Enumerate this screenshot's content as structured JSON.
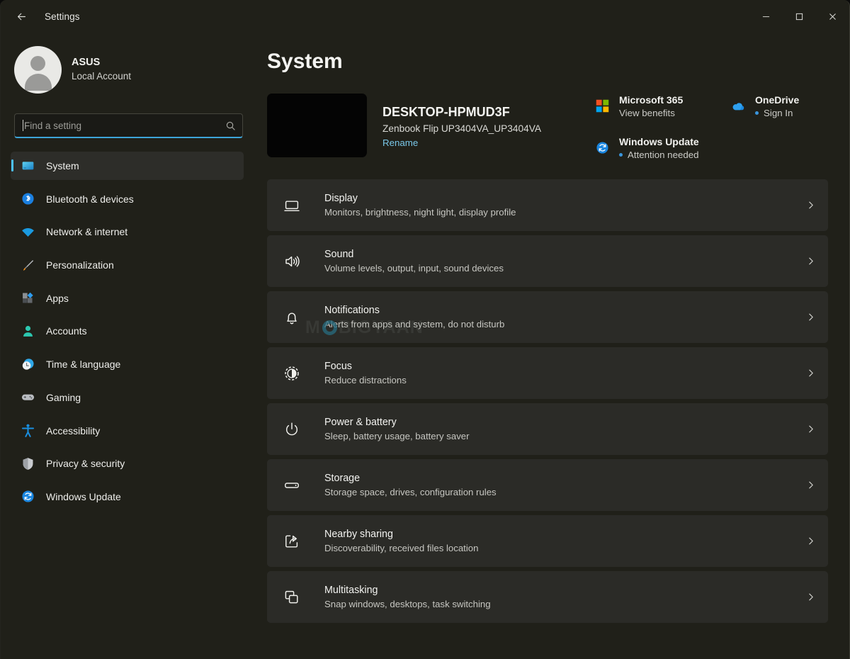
{
  "titlebar": {
    "back_icon": "back-arrow-icon",
    "title": "Settings",
    "minimize_label": "Minimize",
    "maximize_label": "Maximize",
    "close_label": "Close"
  },
  "sidebar": {
    "account": {
      "name": "ASUS",
      "subtitle": "Local Account",
      "avatar_icon": "person-avatar-icon"
    },
    "search": {
      "placeholder": "Find a setting",
      "value": "",
      "icon": "search-icon"
    },
    "items": [
      {
        "label": "System",
        "icon": "monitor-icon",
        "active": true
      },
      {
        "label": "Bluetooth & devices",
        "icon": "bluetooth-icon",
        "active": false
      },
      {
        "label": "Network & internet",
        "icon": "wifi-icon",
        "active": false
      },
      {
        "label": "Personalization",
        "icon": "paintbrush-icon",
        "active": false
      },
      {
        "label": "Apps",
        "icon": "apps-icon",
        "active": false
      },
      {
        "label": "Accounts",
        "icon": "account-person-icon",
        "active": false
      },
      {
        "label": "Time & language",
        "icon": "clock-icon",
        "active": false
      },
      {
        "label": "Gaming",
        "icon": "gamepad-icon",
        "active": false
      },
      {
        "label": "Accessibility",
        "icon": "accessibility-person-icon",
        "active": false
      },
      {
        "label": "Privacy & security",
        "icon": "shield-icon",
        "active": false
      },
      {
        "label": "Windows Update",
        "icon": "update-refresh-icon",
        "active": false
      }
    ]
  },
  "main": {
    "page_title": "System",
    "device": {
      "name": "DESKTOP-HPMUD3F",
      "model": "Zenbook Flip UP3404VA_UP3404VA",
      "rename_label": "Rename",
      "thumbnail_color": "#040404"
    },
    "cloud_cards": [
      {
        "title": "Microsoft 365",
        "subtitle": "View benefits",
        "icon": "microsoft-logo-icon",
        "has_dot": false
      },
      {
        "title": "OneDrive",
        "subtitle": "Sign In",
        "icon": "onedrive-cloud-icon",
        "has_dot": true
      },
      {
        "title": "Windows Update",
        "subtitle": "Attention needed",
        "icon": "update-refresh-icon",
        "has_dot": true
      }
    ],
    "rows": [
      {
        "title": "Display",
        "subtitle": "Monitors, brightness, night light, display profile",
        "icon": "display-monitor-icon"
      },
      {
        "title": "Sound",
        "subtitle": "Volume levels, output, input, sound devices",
        "icon": "speaker-icon"
      },
      {
        "title": "Notifications",
        "subtitle": "Alerts from apps and system, do not disturb",
        "icon": "bell-icon"
      },
      {
        "title": "Focus",
        "subtitle": "Reduce distractions",
        "icon": "focus-moon-icon"
      },
      {
        "title": "Power & battery",
        "subtitle": "Sleep, battery usage, battery saver",
        "icon": "power-icon"
      },
      {
        "title": "Storage",
        "subtitle": "Storage space, drives, configuration rules",
        "icon": "storage-drive-icon"
      },
      {
        "title": "Nearby sharing",
        "subtitle": "Discoverability, received files location",
        "icon": "share-arrow-icon"
      },
      {
        "title": "Multitasking",
        "subtitle": "Snap windows, desktops, task switching",
        "icon": "multitasking-windows-icon"
      }
    ],
    "chevron_icon": "chevron-right-icon"
  },
  "watermark": {
    "text_before": "M",
    "text_after": "BIGYAAN"
  },
  "colors": {
    "accent": "#4cc2ff",
    "link": "#79c7e8",
    "status_dot": "#3a96dd",
    "background": "#202019",
    "card": "#2b2b27"
  }
}
